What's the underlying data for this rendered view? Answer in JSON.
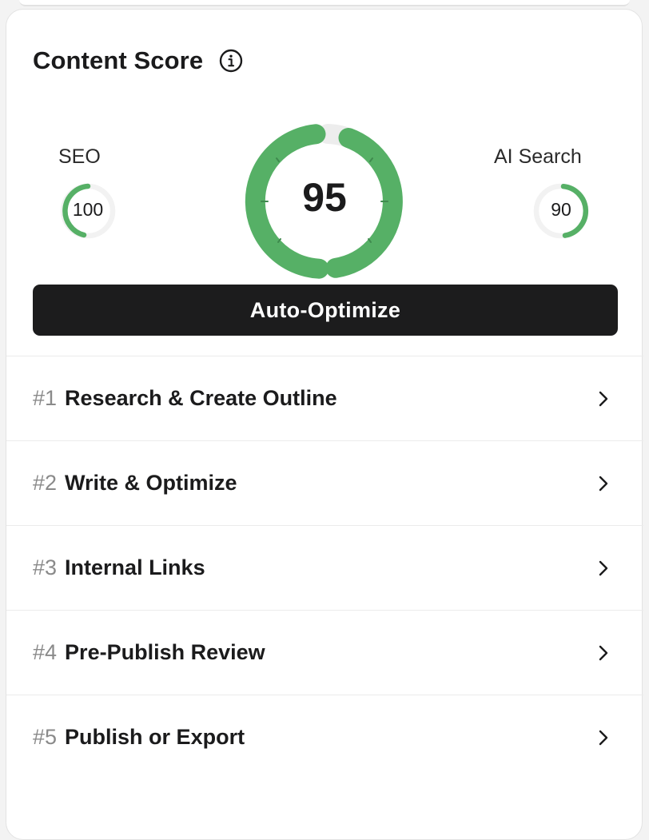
{
  "header": {
    "title": "Content Score",
    "info_icon": "info-icon"
  },
  "scores": {
    "overall": "95",
    "seo": {
      "label": "SEO",
      "value": "100"
    },
    "ai_search": {
      "label": "AI Search",
      "value": "90"
    }
  },
  "colors": {
    "score_green": "#56b066",
    "track_gray": "#efefef",
    "button_dark": "#1c1c1d"
  },
  "actions": {
    "auto_optimize_label": "Auto-Optimize"
  },
  "steps": [
    {
      "num": "#1",
      "label": "Research & Create Outline"
    },
    {
      "num": "#2",
      "label": "Write & Optimize"
    },
    {
      "num": "#3",
      "label": "Internal Links"
    },
    {
      "num": "#4",
      "label": "Pre-Publish Review"
    },
    {
      "num": "#5",
      "label": "Publish or Export"
    }
  ]
}
